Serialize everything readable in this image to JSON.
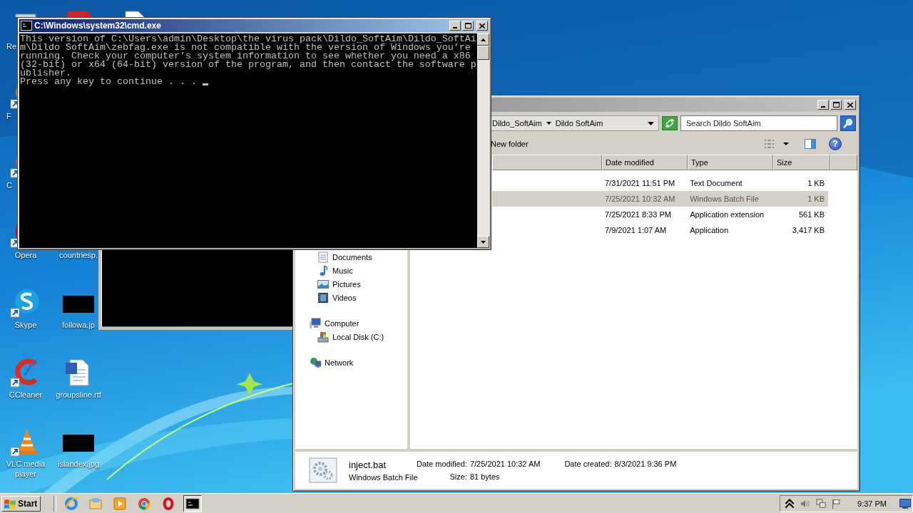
{
  "desktop": {
    "icons": [
      {
        "kind": "recycle",
        "label": "Re",
        "cut": true
      },
      {
        "kind": "app-red"
      },
      {
        "kind": "document"
      },
      {
        "kind": "firefox",
        "label": "F",
        "cut": true
      },
      {
        "kind": "chrome",
        "label": "C",
        "cut": true
      },
      {
        "kind": "opera",
        "label": "Opera",
        "cut": false
      },
      {
        "kind": "covered",
        "label": "countriesp.",
        "cut": false
      },
      {
        "kind": "skype",
        "label": "Skype",
        "cut": false
      },
      {
        "kind": "image",
        "label": "followa.jp",
        "cut": false
      },
      {
        "kind": "ccleaner",
        "label": "CCleaner",
        "cut": false
      },
      {
        "kind": "word",
        "label": "groupsline.rtf",
        "cut": false
      },
      {
        "kind": "vlc",
        "label": "VLC media player",
        "cut": false
      },
      {
        "kind": "image",
        "label": "islandex.jpg",
        "cut": false
      }
    ]
  },
  "console": {
    "title": "C:\\Windows\\system32\\cmd.exe",
    "lines": [
      "This version of C:\\Users\\admin\\Desktop\\the virus pack\\Dildo_SoftAim\\Dildo_SoftAi",
      "m\\Dildo SoftAim\\zebfag.exe is not compatible with the version of Windows you’re",
      "running. Check your computer’s system information to see whether you need a x86",
      "(32-bit) or x64 (64-bit) version of the program, and then contact the software p",
      "ublisher."
    ],
    "prompt": "Press any key to continue . . ."
  },
  "explorer": {
    "breadcrumb": [
      "Dildo_SoftAim",
      "Dildo SoftAim"
    ],
    "search": {
      "placeholder": "Search Dildo SoftAim"
    },
    "toolbar": {
      "new_folder": "New folder",
      "help": "?"
    },
    "columns": [
      "Date modified",
      "Type",
      "Size"
    ],
    "rows": [
      {
        "date": "7/31/2021 11:51 PM",
        "type": "Text Document",
        "size": "1 KB",
        "selected": false
      },
      {
        "date": "7/25/2021 10:32 AM",
        "type": "Windows Batch File",
        "size": "1 KB",
        "selected": true
      },
      {
        "date": "7/25/2021 8:33 PM",
        "type": "Application extension",
        "size": "561 KB",
        "selected": false
      },
      {
        "date": "7/9/2021 1:07 AM",
        "type": "Application",
        "size": "3,417 KB",
        "selected": false
      }
    ],
    "nav": [
      {
        "children": [
          {
            "label": "Documents",
            "kind": "documents"
          },
          {
            "label": "Music",
            "kind": "music"
          },
          {
            "label": "Pictures",
            "kind": "pictures"
          },
          {
            "label": "Videos",
            "kind": "videos"
          }
        ]
      },
      {
        "label": "Computer",
        "kind": "computer",
        "children": [
          {
            "label": "Local Disk (C:)",
            "kind": "disk"
          }
        ]
      },
      {
        "label": "Network",
        "kind": "network"
      }
    ],
    "details": {
      "name": "inject.bat",
      "type": "Windows Batch File",
      "fields": [
        {
          "label": "Date modified:",
          "value": "7/25/2021 10:32 AM"
        },
        {
          "label": "Date created:",
          "value": "8/3/2021 9:36 PM"
        },
        {
          "label": "Size:",
          "value": "81 bytes"
        }
      ]
    }
  },
  "taskbar": {
    "start": "Start",
    "apps": [
      {
        "kind": "ie",
        "selected": false
      },
      {
        "kind": "explorer",
        "selected": false
      },
      {
        "kind": "media",
        "selected": false
      },
      {
        "kind": "chrome",
        "selected": false
      },
      {
        "kind": "opera",
        "selected": false
      },
      {
        "kind": "cmd",
        "selected": true
      }
    ],
    "clock": "9:37 PM"
  }
}
